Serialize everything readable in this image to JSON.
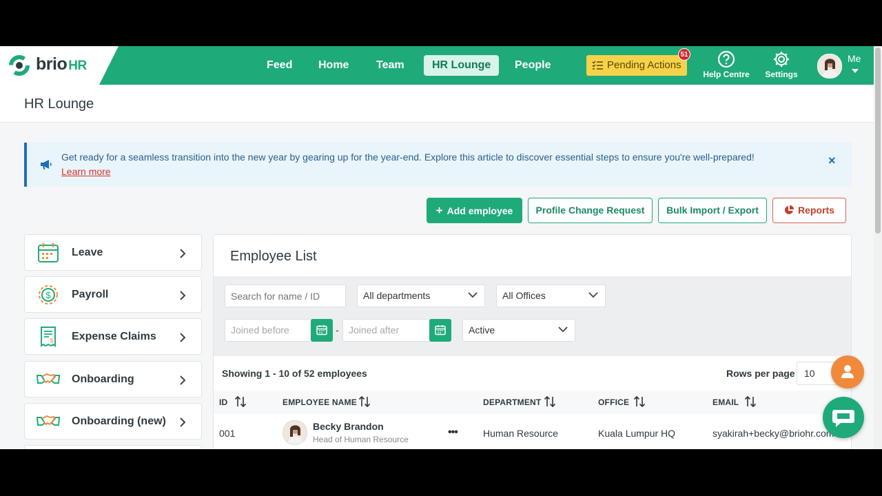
{
  "brand": {
    "name": "brio",
    "suffix": "HR",
    "accent": "#1faa7a"
  },
  "nav": {
    "items": [
      {
        "label": "Feed"
      },
      {
        "label": "Home"
      },
      {
        "label": "Team"
      },
      {
        "label": "HR Lounge",
        "active": true
      },
      {
        "label": "People"
      }
    ],
    "pending_actions": {
      "label": "Pending Actions",
      "count": "51"
    },
    "help_label": "Help Centre",
    "settings_label": "Settings",
    "me_label": "Me"
  },
  "page": {
    "title": "HR Lounge"
  },
  "banner": {
    "text": "Get ready for a seamless transition into the new year by gearing up for the year-end. Explore this article to discover essential steps to ensure you're well-prepared!",
    "link": "Learn more",
    "close": "×"
  },
  "actions": {
    "add_employee": "Add employee",
    "add_icon": "plus-icon",
    "profile_change": "Profile Change Request",
    "bulk_import": "Bulk Import / Export",
    "reports": "Reports",
    "reports_icon": "pie-chart-icon"
  },
  "sidebar": {
    "items": [
      {
        "label": "Leave",
        "icon": "calendar-icon"
      },
      {
        "label": "Payroll",
        "icon": "dollar-coin-icon"
      },
      {
        "label": "Expense Claims",
        "icon": "receipt-icon"
      },
      {
        "label": "Onboarding",
        "icon": "handshake-icon"
      },
      {
        "label": "Onboarding (new)",
        "icon": "handshake-icon"
      }
    ]
  },
  "employee_list": {
    "title": "Employee List",
    "filters": {
      "search_placeholder": "Search for name / ID",
      "department": "All departments",
      "office": "All Offices",
      "joined_before_placeholder": "Joined before",
      "joined_after_placeholder": "Joined after",
      "range_separator": "-",
      "status": "Active"
    },
    "showing": "Showing 1 - 10 of 52 employees",
    "rows_per_page_label": "Rows per page",
    "rows_per_page_value": "10",
    "columns": [
      "ID",
      "EMPLOYEE NAME",
      "DEPARTMENT",
      "OFFICE",
      "EMAIL"
    ],
    "rows": [
      {
        "id": "001",
        "name": "Becky Brandon",
        "title": "Head of Human Resource",
        "department": "Human Resource",
        "office": "Kuala Lumpur HQ",
        "email": "syakirah+becky@briohr.com"
      }
    ]
  }
}
